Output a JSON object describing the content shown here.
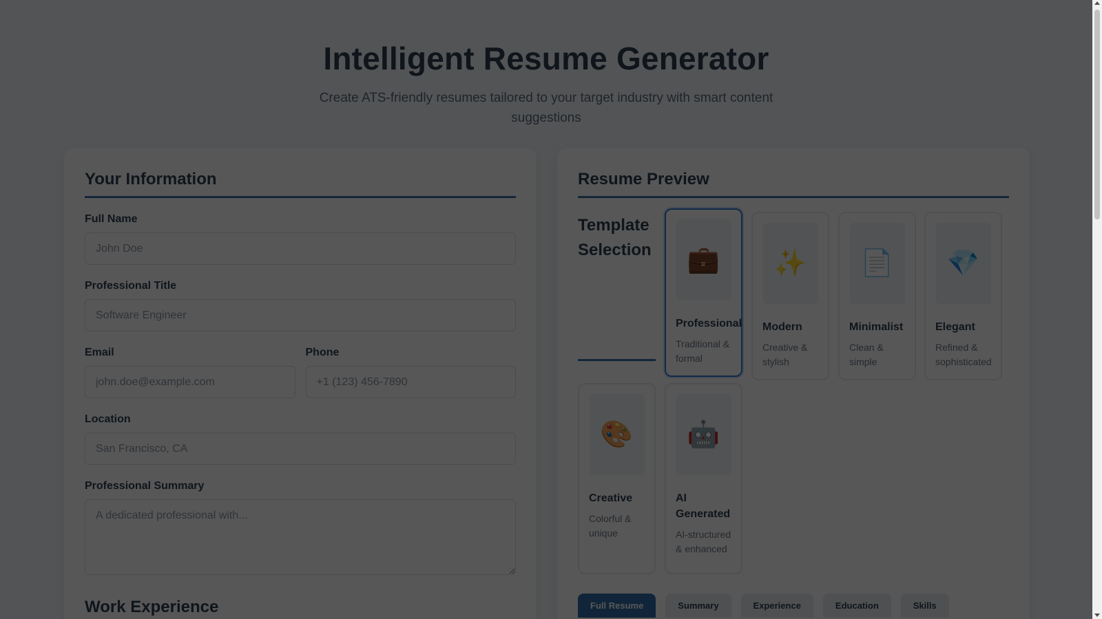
{
  "header": {
    "title": "Intelligent Resume Generator",
    "subtitle": "Create ATS-friendly resumes tailored to your target industry with smart content suggestions"
  },
  "form": {
    "section_title": "Your Information",
    "full_name": {
      "label": "Full Name",
      "placeholder": "John Doe"
    },
    "professional_title": {
      "label": "Professional Title",
      "placeholder": "Software Engineer"
    },
    "email": {
      "label": "Email",
      "placeholder": "john.doe@example.com"
    },
    "phone": {
      "label": "Phone",
      "placeholder": "+1 (123) 456-7890"
    },
    "location": {
      "label": "Location",
      "placeholder": "San Francisco, CA"
    },
    "summary": {
      "label": "Professional Summary",
      "placeholder": "A dedicated professional with..."
    },
    "work_experience_title": "Work Experience"
  },
  "preview": {
    "section_title": "Resume Preview",
    "template_heading": "Template Selection",
    "templates": [
      {
        "name": "Professional",
        "description": "Traditional & formal",
        "icon": "briefcase-icon",
        "glyph": "💼",
        "selected": true
      },
      {
        "name": "Modern",
        "description": "Creative & stylish",
        "icon": "sparkles-icon",
        "glyph": "✨",
        "selected": false
      },
      {
        "name": "Minimalist",
        "description": "Clean & simple",
        "icon": "document-icon",
        "glyph": "📄",
        "selected": false
      },
      {
        "name": "Elegant",
        "description": "Refined & sophisticated",
        "icon": "gem-icon",
        "glyph": "💎",
        "selected": false
      },
      {
        "name": "Creative",
        "description": "Colorful & unique",
        "icon": "palette-icon",
        "glyph": "🎨",
        "selected": false
      },
      {
        "name": "AI Generated",
        "description": "AI-structured & enhanced",
        "icon": "robot-icon",
        "glyph": "🤖",
        "selected": false
      }
    ],
    "tabs": [
      {
        "label": "Full Resume",
        "active": true
      },
      {
        "label": "Summary",
        "active": false
      },
      {
        "label": "Experience",
        "active": false
      },
      {
        "label": "Education",
        "active": false
      },
      {
        "label": "Skills",
        "active": false
      }
    ]
  },
  "colors": {
    "accent": "#3a6fa8",
    "tab_active": "#2f6ca8",
    "background": "#f4f7fb"
  }
}
